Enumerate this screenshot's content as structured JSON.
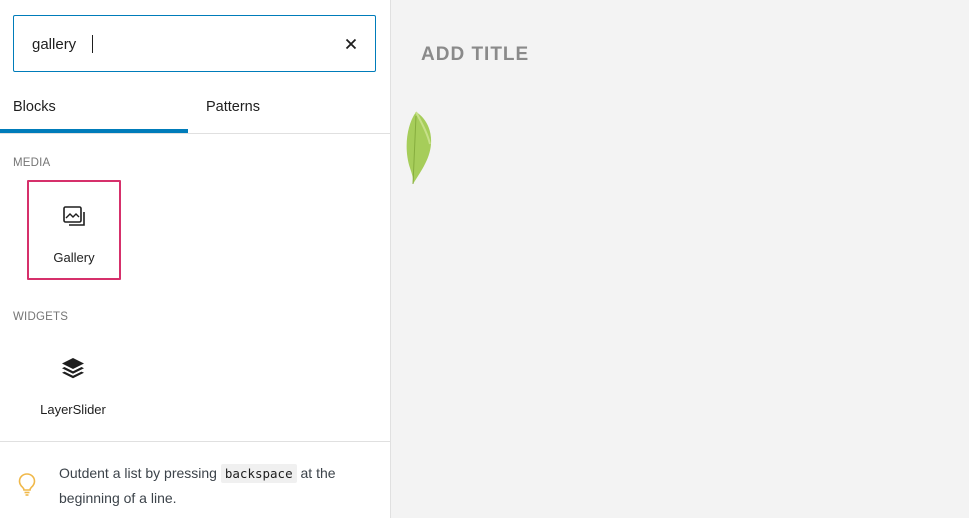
{
  "search": {
    "value": "gallery",
    "clear_label": "Clear search"
  },
  "tabs": [
    {
      "label": "Blocks",
      "active": true
    },
    {
      "label": "Patterns",
      "active": false
    }
  ],
  "categories": [
    {
      "label": "MEDIA",
      "blocks": [
        {
          "label": "Gallery",
          "icon": "gallery-icon",
          "highlighted": true
        }
      ]
    },
    {
      "label": "WIDGETS",
      "blocks": [
        {
          "label": "LayerSlider",
          "icon": "layers-icon",
          "highlighted": false
        }
      ]
    }
  ],
  "tip": {
    "icon": "lightbulb-icon",
    "text_before": "Outdent a list by pressing ",
    "code": "backspace",
    "text_after": " at the beginning of a line."
  },
  "editor": {
    "title_placeholder": "ADD TITLE",
    "image": "leaf-image"
  },
  "colors": {
    "accent": "#007cba",
    "highlight": "#d6306b",
    "tip_icon": "#f0b849",
    "leaf": "#a6cd5a"
  }
}
